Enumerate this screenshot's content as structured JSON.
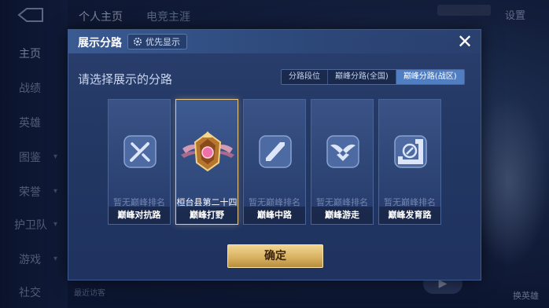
{
  "background": {
    "top_tabs": [
      "个人主页",
      "电竞主涯"
    ],
    "settings_label": "设置",
    "sidebar_items": [
      "主页",
      "战绩",
      "英雄",
      "图鉴",
      "荣誉",
      "护卫队",
      "游戏",
      "社交"
    ],
    "recent_visitors_label": "最近访客",
    "hero_button_label": "换英雄"
  },
  "dialog": {
    "title": "展示分路",
    "priority_label": "优先显示",
    "close_icon": "close-icon",
    "prompt": "请选择展示的分路",
    "segments": [
      {
        "label": "分路段位"
      },
      {
        "label": "巅峰分路(全国)"
      },
      {
        "label": "巅峰分路(战区)"
      }
    ],
    "selected_segment_index": 2,
    "cards": [
      {
        "rank_text": "暂无巅峰排名",
        "label": "巅峰对抗路",
        "icon": "clash-lane-icon",
        "selected": false
      },
      {
        "rank_text": "桓台县第二十四",
        "label": "巅峰打野",
        "icon": "jungle-badge-icon",
        "selected": true
      },
      {
        "rank_text": "暂无巅峰排名",
        "label": "巅峰中路",
        "icon": "mid-lane-icon",
        "selected": false
      },
      {
        "rank_text": "暂无巅峰排名",
        "label": "巅峰游走",
        "icon": "roam-icon",
        "selected": false
      },
      {
        "rank_text": "暂无巅峰排名",
        "label": "巅峰发育路",
        "icon": "farm-lane-icon",
        "selected": false
      }
    ],
    "confirm_label": "确定"
  },
  "colors": {
    "accent_gold": "#e8c98a",
    "segment_selected": "#4f7ec2",
    "dialog_bg": "#233863"
  }
}
